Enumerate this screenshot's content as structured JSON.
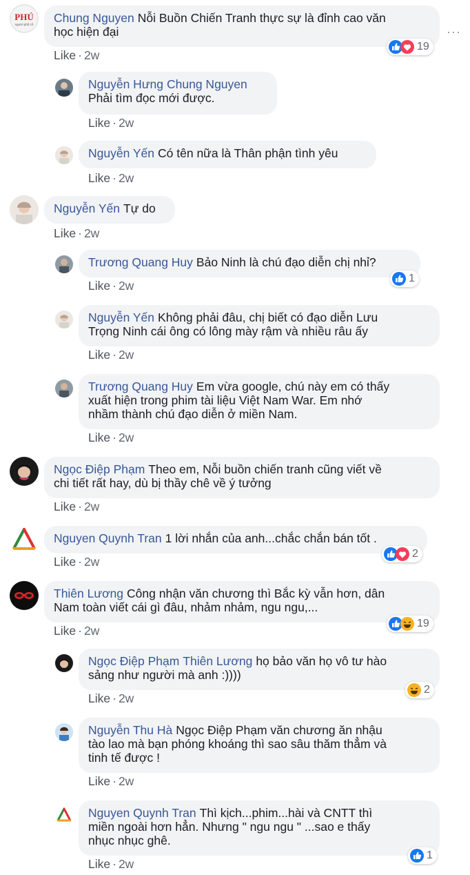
{
  "comments": [
    {
      "name": "Chung Nguyen",
      "tag": "",
      "line1": "Nỗi Buồn Chiến Tranh thực sự là đỉnh cao văn",
      "line2": "học hiện đại",
      "line3": "",
      "like": "Like",
      "time": "2w",
      "reactions": "19"
    },
    {
      "name": "Nguyễn Hưng",
      "tag": "Chung Nguyen",
      "line1": "",
      "line2": "Phải tìm đọc mới được.",
      "line3": "",
      "like": "Like",
      "time": "2w",
      "reactions": ""
    },
    {
      "name": "Nguyễn Yến",
      "tag": "",
      "line1": "Có tên nữa là Thân phận tình yêu",
      "line2": "",
      "line3": "",
      "like": "Like",
      "time": "2w",
      "reactions": ""
    },
    {
      "name": "Nguyễn Yến",
      "tag": "",
      "line1": "Tự do",
      "line2": "",
      "line3": "",
      "like": "Like",
      "time": "2w",
      "reactions": ""
    },
    {
      "name": "Trương Quang Huy",
      "tag": "",
      "line1": "Bảo Ninh là chú đạo diễn chị nhỉ?",
      "line2": "",
      "line3": "",
      "like": "Like",
      "time": "2w",
      "reactions": "1"
    },
    {
      "name": "Nguyễn Yến",
      "tag": "",
      "line1": "Không phải đâu, chị biết có đạo diễn Lưu",
      "line2": "Trọng Ninh cái ông có lông mày rậm và nhiều râu ấy",
      "line3": "",
      "like": "Like",
      "time": "2w",
      "reactions": ""
    },
    {
      "name": "Trương Quang Huy",
      "tag": "",
      "line1": "Em vừa google, chú này em có thấy",
      "line2": "xuất hiện trong phim tài liệu Việt Nam War. Em nhớ",
      "line3": "nhầm thành chú đạo diễn ở miền Nam.",
      "like": "Like",
      "time": "2w",
      "reactions": ""
    },
    {
      "name": "Ngọc Điệp Phạm",
      "tag": "",
      "line1": "Theo em, Nỗi buồn chiến tranh cũng viết về",
      "line2": "chi tiết rất hay, dù bị thầy chê về ý tưởng",
      "line3": "",
      "like": "Like",
      "time": "2w",
      "reactions": ""
    },
    {
      "name": "Nguyen Quynh Tran",
      "tag": "",
      "line1": "1 lời nhắn của anh...chắc chắn bán tốt .",
      "line2": "",
      "line3": "",
      "like": "Like",
      "time": "2w",
      "reactions": "2"
    },
    {
      "name": "Thiên Lương",
      "tag": "",
      "line1": "Công nhận văn chương thì Bắc kỳ vẫn hơn, dân",
      "line2": "Nam toàn viết cái gì đâu, nhảm nhảm, ngu ngu,...",
      "line3": "",
      "like": "Like",
      "time": "2w",
      "reactions": "19"
    },
    {
      "name": "Ngọc Điệp Phạm",
      "tag": "Thiên Lương",
      "line1": "họ bảo văn họ vô tư hào",
      "line2": "sảng như người mà anh :))))",
      "line3": "",
      "like": "Like",
      "time": "2w",
      "reactions": "2"
    },
    {
      "name": "Nguyễn Thu Hà",
      "tag": "",
      "line1": "Ngọc Điệp Phạm văn chương ăn nhậu",
      "line2": "tào lao mà bạn phóng khoáng thì sao sâu thăm thẳm và",
      "line3": "tinh tế được !",
      "like": "Like",
      "time": "2w",
      "reactions": ""
    },
    {
      "name": "Nguyen Quynh Tran",
      "tag": "",
      "line1": "Thì kịch...phim...hài và CNTT thì",
      "line2": "miền ngoài hơn hẳn. Nhưng \" ngu ngu \" ...sao e thấy",
      "line3": "nhục nhục ghê.",
      "like": "Like",
      "time": "2w",
      "reactions": "1"
    }
  ],
  "avatar_labels": {
    "phu_logo": "PHÚ",
    "phu_sub": "người phố cổ"
  },
  "colors": {
    "name": "#385898",
    "bubble": "#f2f3f5",
    "like_blue": "#1877f2",
    "love_red": "#f33e58",
    "haha_yellow": "#f7b125"
  }
}
